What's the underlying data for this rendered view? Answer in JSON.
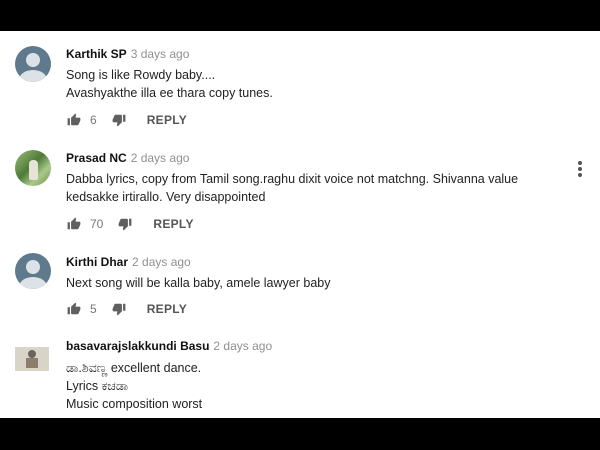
{
  "comments": [
    {
      "author": "Karthik SP",
      "time": "3 days ago",
      "lines": [
        "Song is like Rowdy baby....",
        "Avashyakthe illa ee thara copy tunes."
      ],
      "likes": "6",
      "reply_label": "REPLY",
      "avatar": "default-avatar"
    },
    {
      "author": "Prasad NC",
      "time": "2 days ago",
      "lines": [
        "Dabba lyrics, copy from Tamil song.raghu dixit voice not matchng. Shivanna value",
        "kedsakke irtirallo. Very disappointed"
      ],
      "likes": "70",
      "reply_label": "REPLY",
      "avatar": "photo-avatar"
    },
    {
      "author": "Kirthi Dhar",
      "time": "2 days ago",
      "lines": [
        "Next song will be kalla baby,  amele lawyer baby"
      ],
      "likes": "5",
      "reply_label": "REPLY",
      "avatar": "default-avatar"
    },
    {
      "author": "basavarajslakkundi Basu",
      "time": "2 days ago",
      "lines": [
        "ಡಾ.ಶಿವಣ್ಣ excellent dance.",
        "Lyrics ಕಚಡಾ",
        "Music composition worst"
      ],
      "avatar": "photo-avatar"
    }
  ],
  "icons": {
    "like": "thumbs-up-icon",
    "dislike": "thumbs-down-icon",
    "menu": "more-vert-icon"
  },
  "colors": {
    "author": "#111111",
    "time": "#909090",
    "text": "#222222",
    "action": "#555555"
  }
}
